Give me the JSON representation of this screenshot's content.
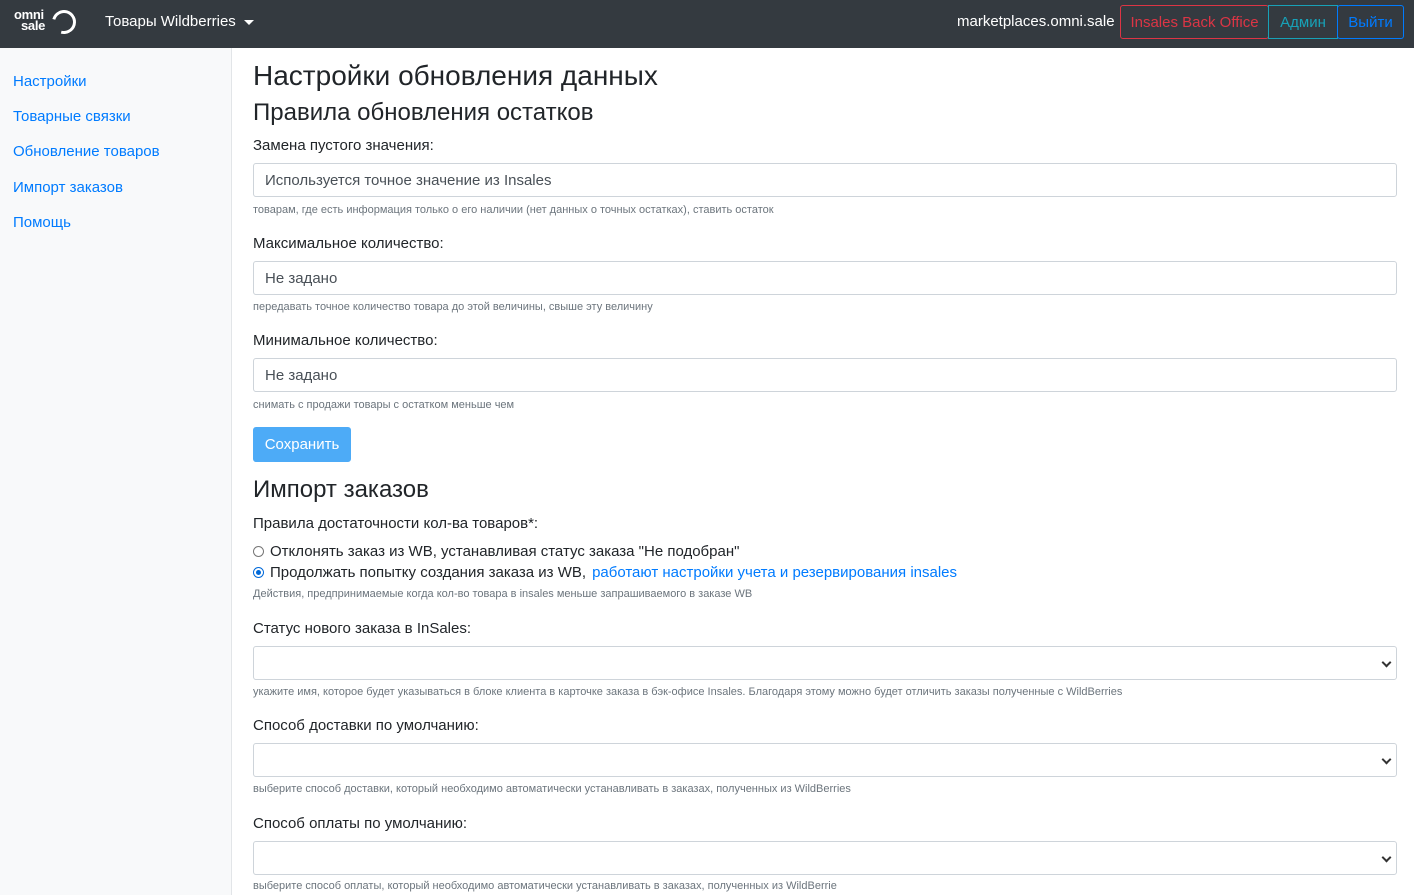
{
  "navbar": {
    "logo_line1": "omni",
    "logo_line2": "sale",
    "brand_dropdown": "Товары Wildberries",
    "host": "marketplaces.omni.sale",
    "buttons": {
      "back_office": "Insales Back Office",
      "admin": "Админ",
      "logout": "Выйти"
    }
  },
  "sidebar": {
    "items": [
      {
        "label": "Настройки"
      },
      {
        "label": "Товарные связки"
      },
      {
        "label": "Обновление товаров"
      },
      {
        "label": "Импорт заказов"
      },
      {
        "label": "Помощь"
      }
    ]
  },
  "main": {
    "page_title": "Настройки обновления данных",
    "stock_section": {
      "title": "Правила обновления остатков",
      "empty_value": {
        "label": "Замена пустого значения:",
        "placeholder": "Используется точное значение из Insales",
        "help": "товарам, где есть информация только о его наличии (нет данных о точных остатках), ставить остаток"
      },
      "max_qty": {
        "label": "Максимальное количество:",
        "placeholder": "Не задано",
        "help": "передавать точное количество товара до этой величины, свыше эту величину"
      },
      "min_qty": {
        "label": "Минимальное количество:",
        "placeholder": "Не задано",
        "help": "снимать с продажи товары с остатком меньше чем"
      },
      "save_label": "Сохранить"
    },
    "orders_section": {
      "title": "Импорт заказов",
      "sufficiency_label": "Правила достаточности кол-ва товаров*:",
      "option_reject": "Отклонять заказ из WB, устанавливая статус заказа \"Не подобран\"",
      "option_continue": "Продолжать попытку создания заказа из WB,",
      "option_continue_link": "работают настройки учета и резервирования insales",
      "selected_option": "continue",
      "sufficiency_help": "Действия, предпринимаемые когда кол-во товара в insales меньше запрашиваемого в заказе WB",
      "status": {
        "label": "Статус нового заказа в InSales:",
        "value": "",
        "help": "укажите имя, которое будет указываться в блоке клиента в карточке заказа в бэк-офисе Insales. Благодаря этому можно будет отличить заказы полученные с WildBerries"
      },
      "delivery": {
        "label": "Способ доставки по умолчанию:",
        "value": "",
        "help": "выберите способ доставки, который необходимо автоматически устанавливать в заказах, полученных из WildBerries"
      },
      "payment": {
        "label": "Способ оплаты по умолчанию:",
        "value": "",
        "help": "выберите способ оплаты, который необходимо автоматически устанавливать в заказах, полученных из WildBerrie"
      }
    }
  }
}
